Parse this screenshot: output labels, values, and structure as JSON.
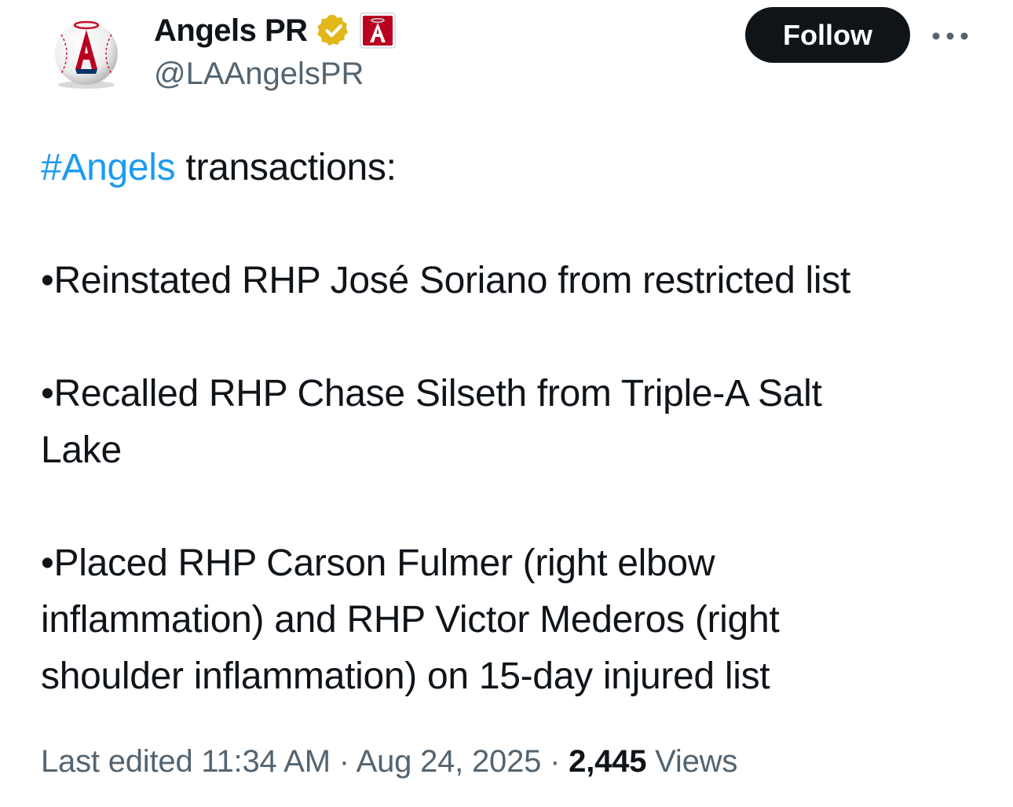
{
  "author": {
    "display_name": "Angels PR",
    "handle": "@LAAngelsPR",
    "avatar_icon": "angels-baseball-logo-icon",
    "verified_badge_icon": "gold-verified-badge-icon",
    "affiliate_icon": "angels-affiliate-badge-icon"
  },
  "actions": {
    "follow_label": "Follow",
    "more_icon": "more-horizontal-icon"
  },
  "tweet": {
    "hashtag": "#Angels",
    "intro_rest": " transactions:",
    "line1": "•Reinstated RHP José Soriano from restricted list",
    "line2a": "•Recalled RHP Chase Silseth from Triple-A Salt",
    "line2b": "Lake",
    "line3a": "•Placed RHP Carson Fulmer (right elbow",
    "line3b": "inflammation) and RHP Victor Mederos (right",
    "line3c": "shoulder inflammation) on 15-day injured list"
  },
  "meta": {
    "edited_label": "Last edited 11:34 AM",
    "separator": " · ",
    "date": "Aug 24, 2025",
    "views_count": "2,445",
    "views_label": " Views"
  },
  "colors": {
    "text": "#0f1419",
    "secondary": "#536471",
    "link": "#1d9bf0",
    "angels_red": "#ba0021",
    "badge_gold": "#e2b719",
    "follow_bg": "#0f1419"
  }
}
